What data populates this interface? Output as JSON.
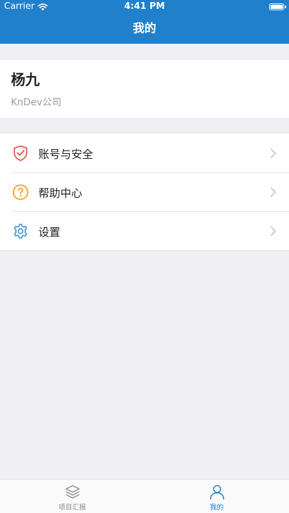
{
  "status_bar": {
    "carrier": "Carrier",
    "time": "4:41 PM",
    "battery_level": 1.0
  },
  "nav": {
    "title": "我的"
  },
  "profile": {
    "name": "杨九",
    "company": "KnDev公司"
  },
  "menu": {
    "items": [
      {
        "label": "账号与安全",
        "icon": "shield-check-icon"
      },
      {
        "label": "帮助中心",
        "icon": "help-circle-icon"
      },
      {
        "label": "设置",
        "icon": "gear-icon"
      }
    ]
  },
  "tabbar": {
    "tabs": [
      {
        "label": "项目汇报",
        "icon": "layers-icon",
        "selected": false
      },
      {
        "label": "我的",
        "icon": "user-icon",
        "selected": true
      }
    ]
  },
  "colors": {
    "header_bg": "#2080cc",
    "accent": "#2080cc",
    "page_bg": "#efeff4",
    "security_icon": "#e05a4f",
    "help_icon": "#f0a020",
    "settings_icon": "#3a8fd0",
    "tab_inactive": "#8a8a8a"
  }
}
